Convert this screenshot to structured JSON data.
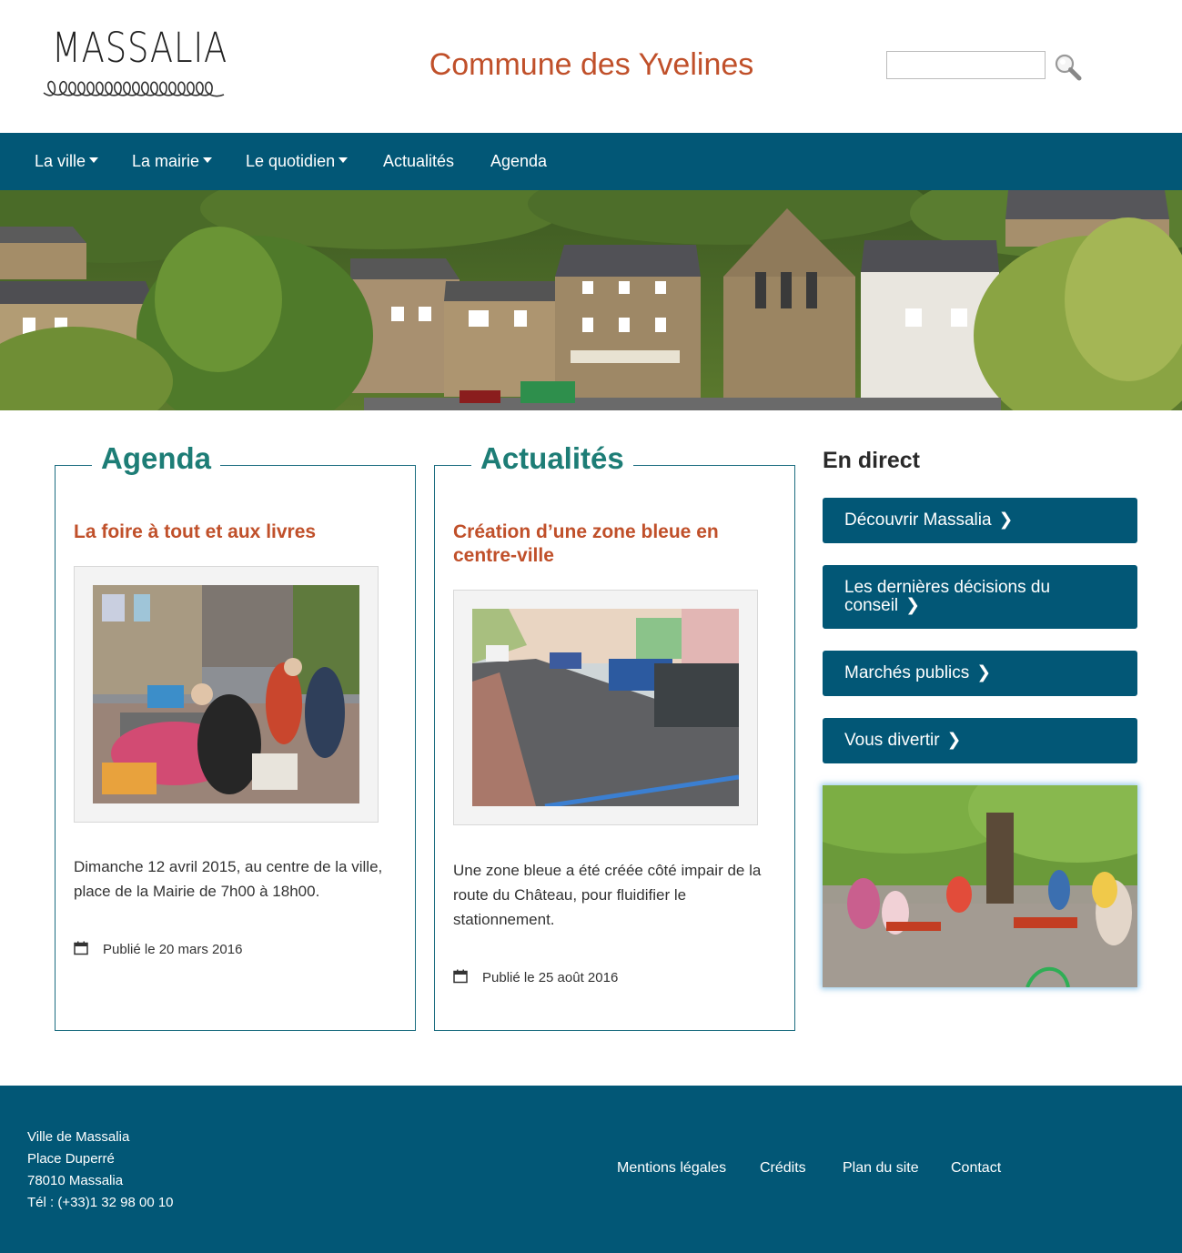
{
  "header": {
    "logo_text": "MASSALIA",
    "title": "Commune des Yvelines",
    "search": {
      "value": "",
      "placeholder": ""
    }
  },
  "nav": {
    "items": [
      {
        "label": "La ville",
        "dropdown": true
      },
      {
        "label": "La mairie",
        "dropdown": true
      },
      {
        "label": "Le quotidien",
        "dropdown": true
      },
      {
        "label": "Actualités",
        "dropdown": false
      },
      {
        "label": "Agenda",
        "dropdown": false
      }
    ]
  },
  "agenda": {
    "heading": "Agenda",
    "headline": "La foire à tout et aux livres",
    "text": "Dimanche 12 avril 2015, au centre de la ville, place de la Mairie de 7h00 à 18h00.",
    "published": "Publié le 20 mars 2016"
  },
  "news": {
    "heading": "Actualités",
    "headline": "Création d’une zone bleue en centre-ville",
    "text": "Une zone bleue a été créée côté impair de la route du Château, pour fluidifier le stationnement.",
    "published": "Publié le 25 août 2016"
  },
  "aside": {
    "heading": "En direct",
    "buttons": [
      {
        "label": "Découvrir Massalia"
      },
      {
        "label": "Les dernières décisions du conseil"
      },
      {
        "label": "Marchés publics"
      },
      {
        "label": "Vous divertir"
      }
    ]
  },
  "footer": {
    "address": [
      "Ville de Massalia",
      "Place Duperré",
      "78010 Massalia",
      "Tél : (+33)1 32 98 00 10"
    ],
    "links": [
      "Mentions légales",
      "Crédits",
      "Plan du site",
      "Contact"
    ]
  },
  "icons": {
    "search": "magnifier-icon",
    "calendar": "calendar-icon",
    "caret": "caret-down-icon",
    "chevron": "chevron-right-icon"
  },
  "colors": {
    "brand_blue": "#025776",
    "title_orange": "#c0502a",
    "heading_teal": "#1d7d76"
  }
}
